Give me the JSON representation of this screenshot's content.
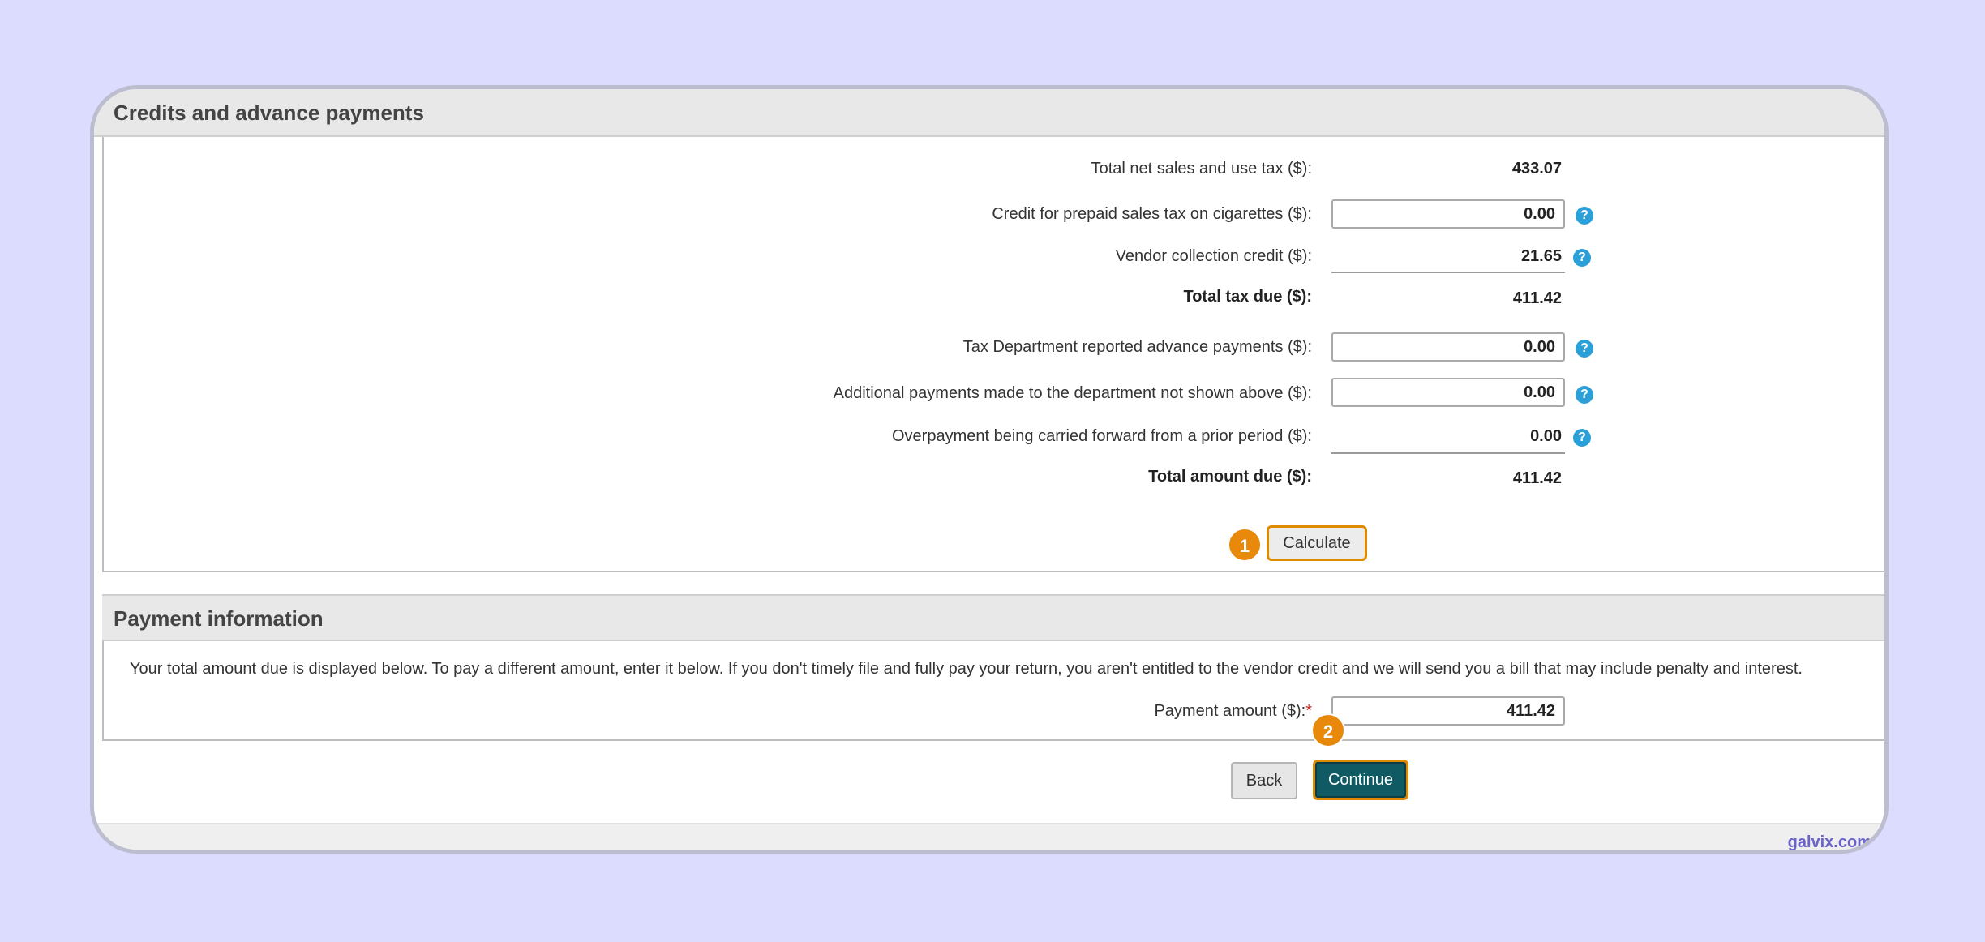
{
  "credits": {
    "title": "Credits and advance payments",
    "rows": {
      "total_net_sales_label": "Total net sales and use tax ($):",
      "total_net_sales_value": "433.07",
      "cigarettes_label": "Credit for prepaid sales tax on cigarettes ($):",
      "cigarettes_value": "0.00",
      "vendor_credit_label": "Vendor collection credit ($):",
      "vendor_credit_value": "21.65",
      "total_tax_due_label": "Total tax due ($):",
      "total_tax_due_value": "411.42",
      "advance_payments_label": "Tax Department reported advance payments ($):",
      "advance_payments_value": "0.00",
      "additional_payments_label": "Additional payments made to the department not shown above ($):",
      "additional_payments_value": "0.00",
      "overpayment_label": "Overpayment being carried forward from a prior period ($):",
      "overpayment_value": "0.00",
      "total_amount_due_label": "Total amount due ($):",
      "total_amount_due_value": "411.42"
    },
    "help_glyph": "?",
    "calculate_label": "Calculate",
    "step_1": "1"
  },
  "payment": {
    "title": "Payment information",
    "info_text": "Your total amount due is displayed below. To pay a different amount, enter it below. If you don't timely file and fully pay your return, you aren't entitled to the vendor credit and we will send you a bill that may include penalty and interest.",
    "amount_label": "Payment amount ($):",
    "required_mark": "*",
    "amount_value": "411.42",
    "step_2": "2"
  },
  "actions": {
    "back_label": "Back",
    "continue_label": "Continue"
  },
  "watermark": "galvix.com",
  "colors": {
    "accent_orange": "#e8890b",
    "continue_teal": "#0f5a63",
    "help_blue": "#2a9fd8",
    "background": "#dcdcff"
  }
}
